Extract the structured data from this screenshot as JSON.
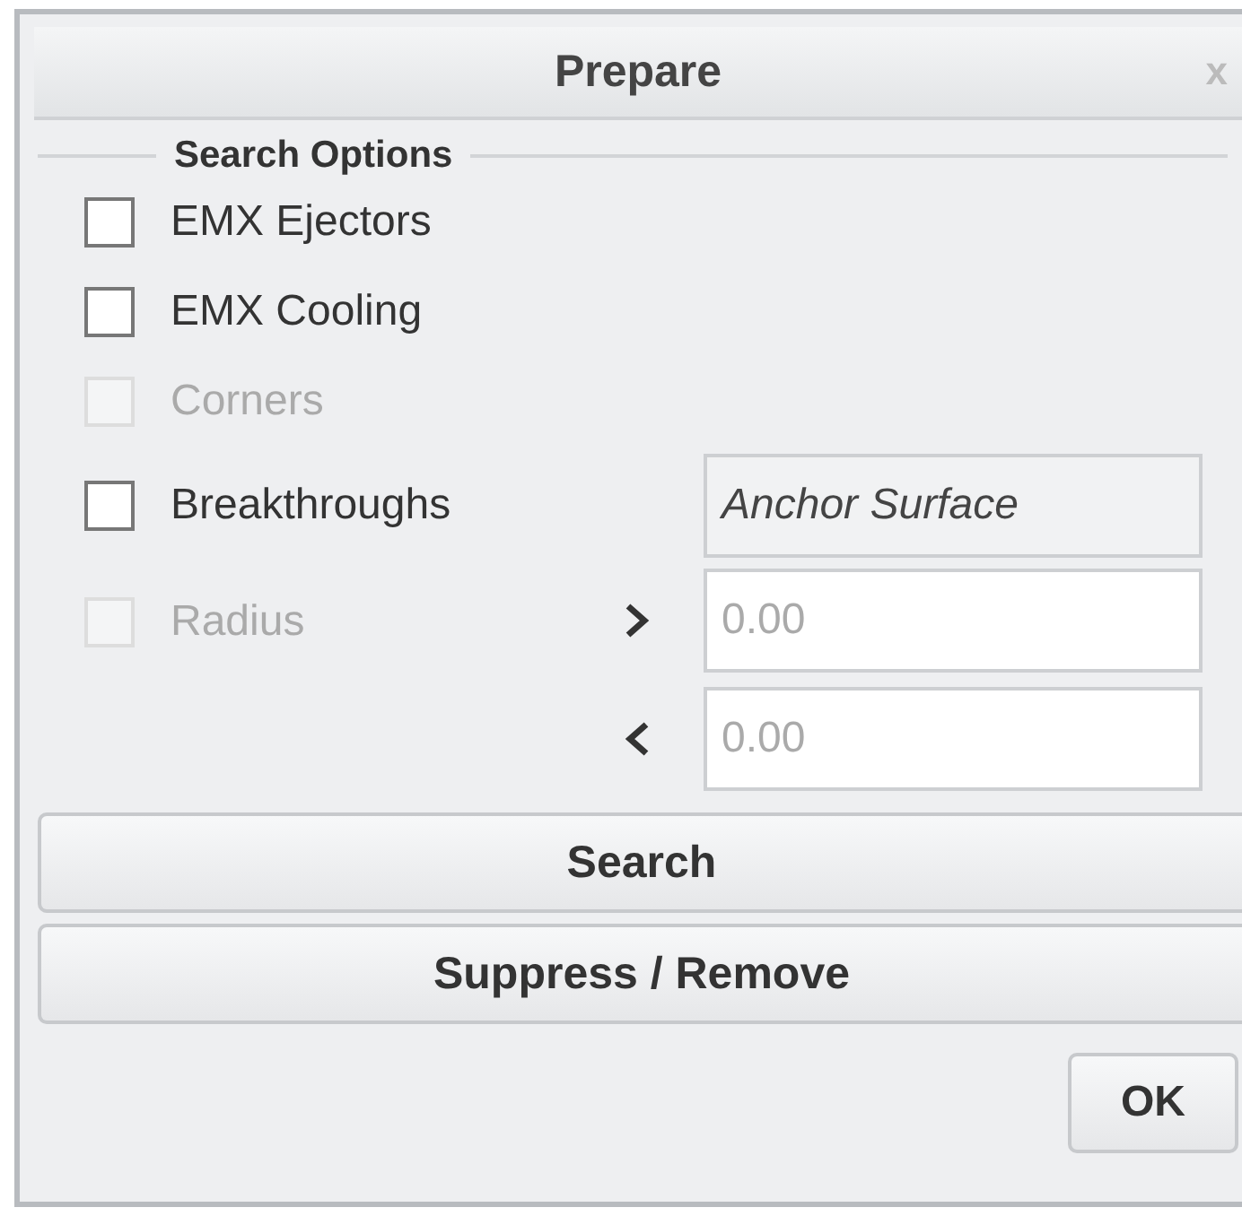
{
  "window": {
    "title": "Prepare",
    "close": "x"
  },
  "search_options": {
    "legend": "Search Options",
    "options": [
      {
        "label": "EMX Ejectors",
        "checked": false,
        "disabled": false
      },
      {
        "label": "EMX Cooling",
        "checked": false,
        "disabled": false
      },
      {
        "label": "Corners",
        "checked": false,
        "disabled": true
      },
      {
        "label": "Breakthroughs",
        "checked": false,
        "disabled": false
      }
    ],
    "anchor_field": {
      "value": "Anchor Surface"
    },
    "radius": {
      "label": "Radius",
      "checked": false,
      "disabled": true
    },
    "radius_fields": [
      {
        "kind": "greater",
        "value": "0.00",
        "disabled": true
      },
      {
        "kind": "less",
        "value": "0.00",
        "disabled": true
      }
    ]
  },
  "buttons": [
    {
      "label": "Search"
    },
    {
      "label": "Suppress / Remove"
    }
  ],
  "ok_button": {
    "label": "OK"
  }
}
